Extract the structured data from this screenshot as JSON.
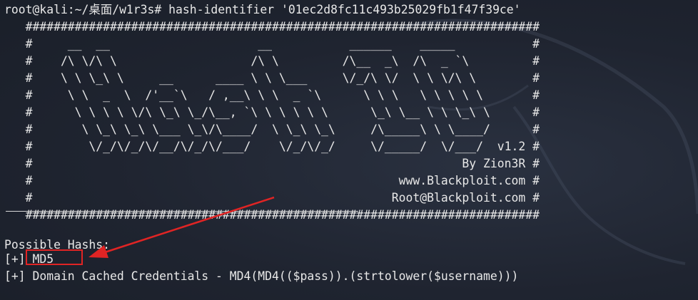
{
  "terminal": {
    "prompt": "root@kali:~/桌面/w1r3s# hash-identifier '01ec2d8fc11c493b25029fb1f47f39ce'",
    "banner": [
      "   #########################################################################",
      "   #     __  __                     __           ______    _____           #",
      "   #    /\\ \\/\\ \\                   /\\ \\         /\\__  _\\  /\\  _ `\\         #",
      "   #    \\ \\ \\_\\ \\     __      ____ \\ \\ \\___     \\/_/\\ \\/  \\ \\ \\/\\ \\        #",
      "   #     \\ \\  _  \\  /'__`\\   / ,__\\ \\ \\  _ `\\      \\ \\ \\   \\ \\ \\ \\ \\       #",
      "   #      \\ \\ \\ \\ \\/\\ \\_\\ \\_/\\__, `\\ \\ \\ \\ \\ \\      \\_\\ \\__ \\ \\ \\_\\ \\      #",
      "   #       \\ \\_\\ \\_\\ \\___ \\_\\/\\____/  \\ \\_\\ \\_\\     /\\_____\\ \\ \\____/      #",
      "   #        \\/_/\\/_/\\/__/\\/_/\\/___/    \\/_/\\/_/     \\/_____/  \\/___/  v1.2 #",
      "   #                                                             By Zion3R #",
      "   #                                                    www.Blackploit.com #",
      "   #                                                   Root@Blackploit.com #",
      "   #########################################################################"
    ],
    "possible_heading": "Possible Hashs:",
    "results": [
      "[+] MD5",
      "[+] Domain Cached Credentials - MD4(MD4(($pass)).(strtolower($username)))"
    ]
  },
  "colors": {
    "background": "#1f2430",
    "text": "#e8e8e8",
    "annotation": "#e02424"
  }
}
